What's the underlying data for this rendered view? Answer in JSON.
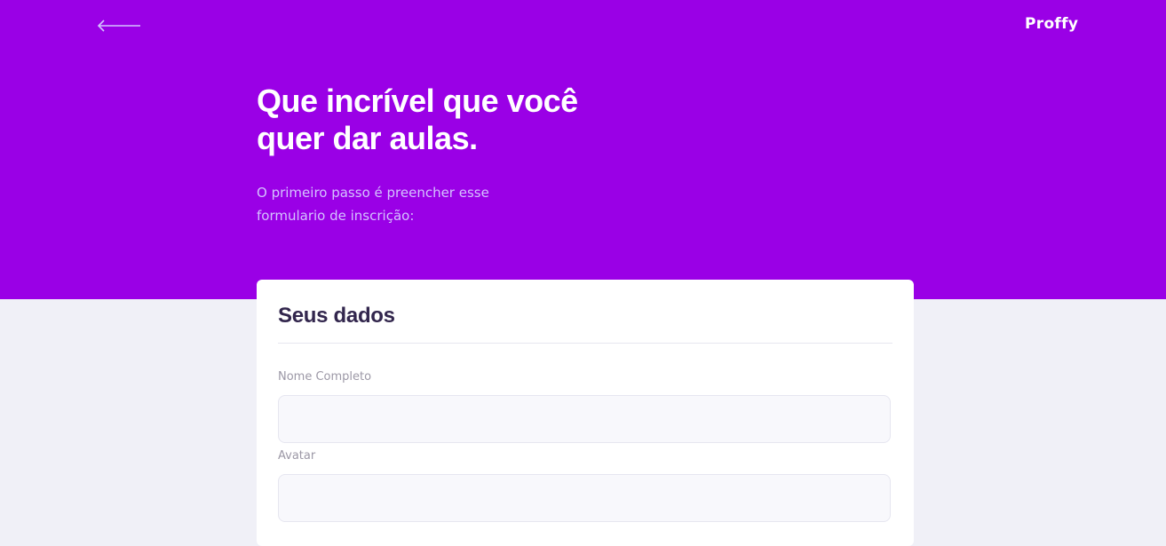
{
  "header": {
    "back_icon": "arrow-left-icon",
    "logo_text": "Proffy"
  },
  "hero": {
    "title_line1": "Que incrível que você",
    "title_line2": "quer dar aulas.",
    "subtitle_line1": "O primeiro passo é preencher esse",
    "subtitle_line2": "formulario de inscrição:"
  },
  "form": {
    "section_title": "Seus dados",
    "fields": [
      {
        "label": "Nome Completo",
        "value": "",
        "placeholder": ""
      },
      {
        "label": "Avatar",
        "value": "",
        "placeholder": ""
      }
    ]
  },
  "colors": {
    "primary": "#9A00E6",
    "background": "#F0F0F7",
    "card": "#FFFFFF",
    "title_text": "#32264D",
    "label_text": "#9C98A6",
    "input_bg": "#F8F8FC"
  }
}
